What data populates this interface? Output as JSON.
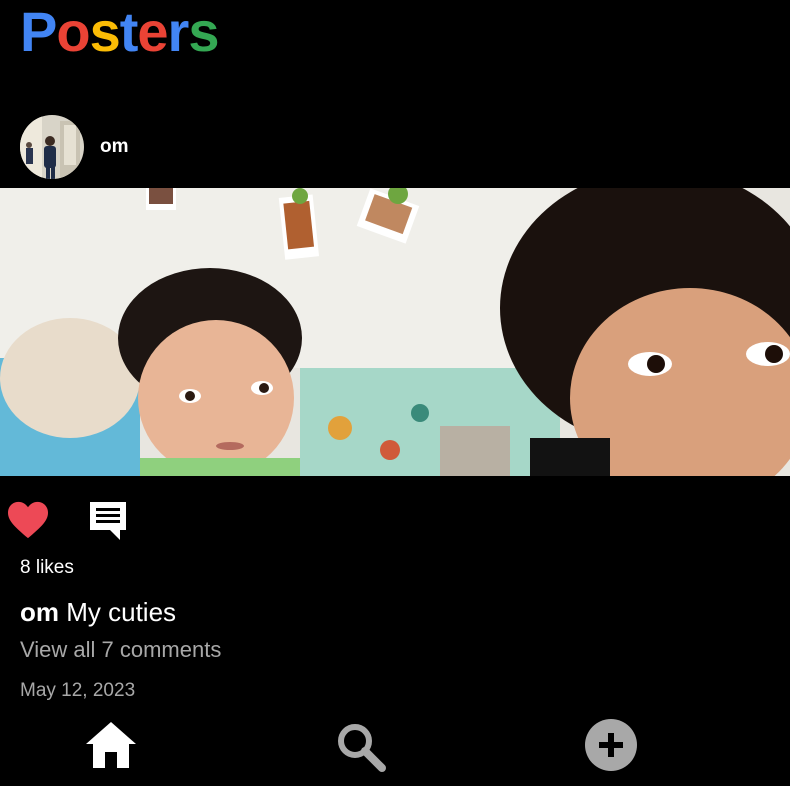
{
  "app": {
    "logo_letters": [
      {
        "char": "P",
        "color": "#4285F4"
      },
      {
        "char": "o",
        "color": "#EA4335"
      },
      {
        "char": "s",
        "color": "#FBBC05"
      },
      {
        "char": "t",
        "color": "#4285F4"
      },
      {
        "char": "e",
        "color": "#EA4335"
      },
      {
        "char": "r",
        "color": "#4285F4"
      },
      {
        "char": "s",
        "color": "#34A853"
      }
    ]
  },
  "post": {
    "username": "om",
    "avatar_icon": "profile-photo",
    "photo_icon": "post-photo-two-children",
    "liked": true,
    "like_color": "#ED4956",
    "likes_text": "8 likes",
    "caption_user": "om",
    "caption_text": "My cuties",
    "view_comments": "View all 7 comments",
    "date": "May 12, 2023"
  },
  "nav": {
    "home_icon": "home-icon",
    "search_icon": "search-icon",
    "add_icon": "add-circle-icon"
  }
}
